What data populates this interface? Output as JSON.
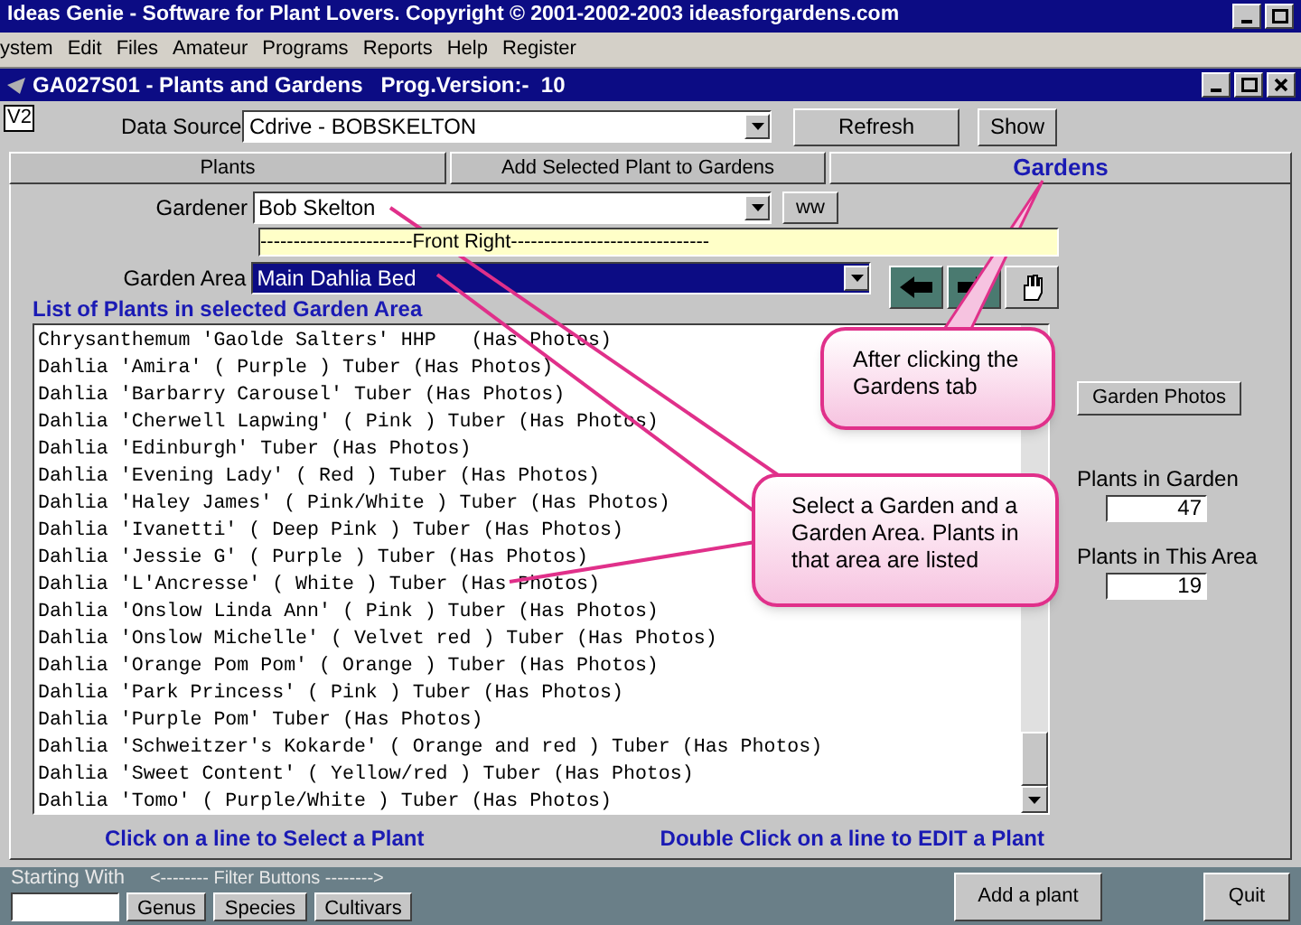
{
  "app_title": "Ideas Genie  - Software for Plant Lovers. Copyright © 2001-2002-2003 ideasforgardens.com",
  "menu": [
    "ystem",
    "Edit",
    "Files",
    "Amateur",
    "Programs",
    "Reports",
    "Help",
    "Register"
  ],
  "window": {
    "title": "GA027S01 - Plants and Gardens   Prog.Version:-  10"
  },
  "version_tag": "V2",
  "data_source": {
    "label": "Data Source",
    "value": "Cdrive - BOBSKELTON"
  },
  "top_buttons": [
    "Refresh",
    "Show"
  ],
  "tabs": [
    {
      "label": "Plants",
      "selected": false
    },
    {
      "label": "Add Selected Plant to Gardens",
      "selected": false
    },
    {
      "label": "Gardens",
      "selected": true
    }
  ],
  "gardener": {
    "label": "Gardener",
    "value": "Bob Skelton",
    "button": "ww"
  },
  "area_note": "-----------------------Front Right------------------------------",
  "garden_area": {
    "label": "Garden Area",
    "value": "Main Dahlia Bed"
  },
  "list_heading": "List of Plants in selected Garden Area",
  "plants": [
    "Chrysanthemum 'Gaolde Salters' HHP   (Has Photos)",
    "Dahlia 'Amira' ( Purple ) Tuber (Has Photos)",
    "Dahlia 'Barbarry Carousel' Tuber (Has Photos)",
    "Dahlia 'Cherwell Lapwing' ( Pink ) Tuber (Has Photos)",
    "Dahlia 'Edinburgh' Tuber (Has Photos)",
    "Dahlia 'Evening Lady' ( Red ) Tuber (Has Photos)",
    "Dahlia 'Haley James' ( Pink/White ) Tuber (Has Photos)",
    "Dahlia 'Ivanetti' ( Deep Pink ) Tuber (Has Photos)",
    "Dahlia 'Jessie G' ( Purple ) Tuber (Has Photos)",
    "Dahlia 'L'Ancresse' ( White ) Tuber (Has Photos)",
    "Dahlia 'Onslow Linda Ann' ( Pink ) Tuber (Has Photos)",
    "Dahlia 'Onslow Michelle' ( Velvet red ) Tuber (Has Photos)",
    "Dahlia 'Orange Pom Pom' ( Orange ) Tuber (Has Photos)",
    "Dahlia 'Park Princess' ( Pink ) Tuber (Has Photos)",
    "Dahlia 'Purple Pom' Tuber (Has Photos)",
    "Dahlia 'Schweitzer's Kokarde' ( Orange and red ) Tuber (Has Photos)",
    "Dahlia 'Sweet Content' ( Yellow/red ) Tuber (Has Photos)",
    "Dahlia 'Tomo' ( Purple/White ) Tuber (Has Photos)"
  ],
  "garden_photos_button": "Garden Photos",
  "stats": [
    {
      "label": "Plants in Garden",
      "value": "47"
    },
    {
      "label": "Plants in This Area",
      "value": "19"
    }
  ],
  "hints": [
    "Click on a line to Select a Plant",
    "Double Click on a line to EDIT a Plant"
  ],
  "footer": {
    "starting_with": "Starting With",
    "filter_label": "<-------- Filter Buttons -------->",
    "filter_buttons": [
      "Genus",
      "Species",
      "Cultivars"
    ],
    "add_button": "Add a plant",
    "quit_button": "Quit"
  },
  "callouts": [
    "After clicking the Gardens tab",
    "Select a Garden and a Garden Area. Plants in that area are listed"
  ]
}
